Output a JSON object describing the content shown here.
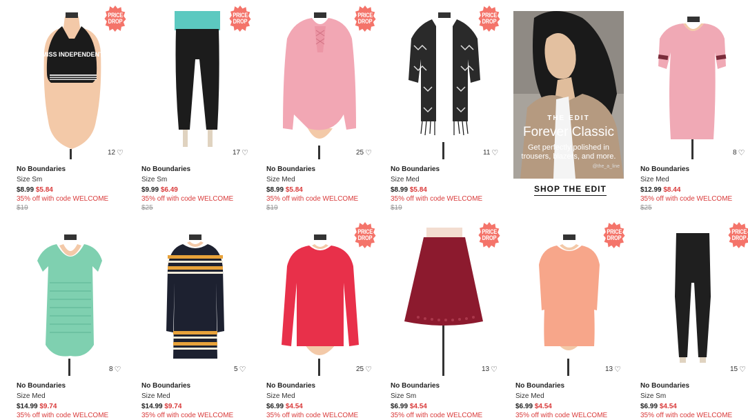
{
  "products": [
    {
      "brand": "No Boundaries",
      "size": "Size Sm",
      "orig": "$8.99",
      "sale": "$5.84",
      "promo": "35% off with code WELCOME",
      "retail": "$19",
      "likes": "12",
      "badge": "PRICE DROP",
      "item": "halter-crop-top",
      "color": "#1b1b1b"
    },
    {
      "brand": "No Boundaries",
      "size": "Size Sm",
      "orig": "$9.99",
      "sale": "$6.49",
      "promo": "35% off with code WELCOME",
      "retail": "$25",
      "likes": "17",
      "badge": "PRICE DROP",
      "item": "yoga-pants",
      "color": "#1c1c1c"
    },
    {
      "brand": "No Boundaries",
      "size": "Size Med",
      "orig": "$8.99",
      "sale": "$5.84",
      "promo": "35% off with code WELCOME",
      "retail": "$19",
      "likes": "25",
      "badge": "PRICE DROP",
      "item": "lace-blouse",
      "color": "#f2a7b4"
    },
    {
      "brand": "No Boundaries",
      "size": "Size Med",
      "orig": "$8.99",
      "sale": "$5.84",
      "promo": "35% off with code WELCOME",
      "retail": "$19",
      "likes": "11",
      "badge": "PRICE DROP",
      "item": "print-cardigan",
      "color": "#222222"
    },
    {
      "brand": "No Boundaries",
      "size": "Size Med",
      "orig": "$12.99",
      "sale": "$8.44",
      "promo": "35% off with code WELCOME",
      "retail": "$25",
      "likes": "8",
      "badge": "",
      "item": "pink-tshirt-dress",
      "color": "#f0a9b5"
    },
    {
      "brand": "No Boundaries",
      "size": "Size Med",
      "orig": "$14.99",
      "sale": "$9.74",
      "promo": "35% off with code WELCOME",
      "retail": "",
      "likes": "8",
      "badge": "",
      "item": "smocked-dress",
      "color": "#7fd0b0"
    },
    {
      "brand": "No Boundaries",
      "size": "Size Med",
      "orig": "$14.99",
      "sale": "$9.74",
      "promo": "35% off with code WELCOME",
      "retail": "",
      "likes": "5",
      "badge": "",
      "item": "striped-sweater-dress",
      "color": "#1d2130"
    },
    {
      "brand": "No Boundaries",
      "size": "Size Med",
      "orig": "$6.99",
      "sale": "$4.54",
      "promo": "35% off with code WELCOME",
      "retail": "",
      "likes": "25",
      "badge": "PRICE DROP",
      "item": "red-long-sleeve-tee",
      "color": "#e8304a"
    },
    {
      "brand": "No Boundaries",
      "size": "Size Sm",
      "orig": "$6.99",
      "sale": "$4.54",
      "promo": "35% off with code WELCOME",
      "retail": "",
      "likes": "13",
      "badge": "PRICE DROP",
      "item": "burgundy-skirt",
      "color": "#8c1a2e"
    },
    {
      "brand": "No Boundaries",
      "size": "Size Med",
      "orig": "$6.99",
      "sale": "$4.54",
      "promo": "35% off with code WELCOME",
      "retail": "",
      "likes": "13",
      "badge": "PRICE DROP",
      "item": "peach-top",
      "color": "#f7a68a"
    },
    {
      "brand": "No Boundaries",
      "size": "Size Sm",
      "orig": "$6.99",
      "sale": "$4.54",
      "promo": "35% off with code WELCOME",
      "retail": "",
      "likes": "15",
      "badge": "PRICE DROP",
      "item": "black-leggings",
      "color": "#1f1f1f"
    }
  ],
  "graphic_text": {
    "top_print": "MISS INDEPENDENT"
  },
  "edit": {
    "kicker": "THE EDIT",
    "title": "Forever Classic",
    "subtitle": "Get perfectly polished in trousers, blazers, and more.",
    "credit": "@the_a_line",
    "cta": "SHOP THE EDIT"
  },
  "colors": {
    "sale": "#d93a3a",
    "badge": "#f4746a"
  }
}
